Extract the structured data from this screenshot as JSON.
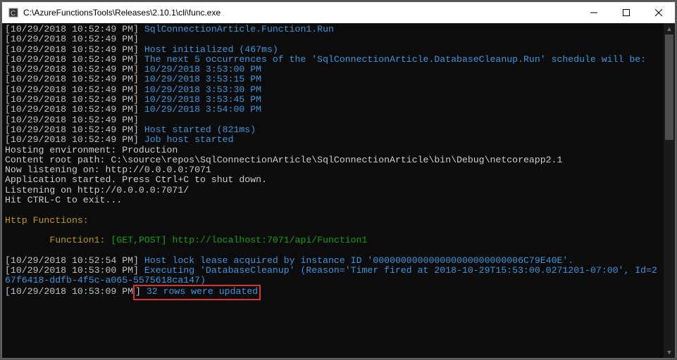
{
  "window": {
    "title": "C:\\AzureFunctionsTools\\Releases\\2.10.1\\cli\\func.exe"
  },
  "log": {
    "ts1": "[10/29/2018 10:52:49 PM]",
    "l1": "SqlConnectionArticle.Function1.Run",
    "l2": "Host initialized (467ms)",
    "l3": "The next 5 occurrences of the 'SqlConnectionArticle.DatabaseCleanup.Run' schedule will be:",
    "l4": "10/29/2018 3:53:00 PM",
    "l5": "10/29/2018 3:53:15 PM",
    "l6": "10/29/2018 3:53:30 PM",
    "l7": "10/29/2018 3:53:45 PM",
    "l8": "10/29/2018 3:54:00 PM",
    "l9": "Host started (821ms)",
    "l10": "Job host started",
    "env": "Hosting environment: Production",
    "root": "Content root path: C:\\source\\repos\\SqlConnectionArticle\\SqlConnectionArticle\\bin\\Debug\\netcoreapp2.1",
    "listen1": "Now listening on: http://0.0.0.0:7071",
    "appstart": "Application started. Press Ctrl+C to shut down.",
    "listen2": "Listening on http://0.0.0.0:7071/",
    "ctrlc": "Hit CTRL-C to exit...",
    "httpHeader": "Http Functions:",
    "fn1label": "Function1:",
    "fn1methods": "[GET,POST]",
    "fn1url": "http://localhost:7071/api/Function1",
    "ts2": "[10/29/2018 10:52:54 PM]",
    "lease": "Host lock lease acquired by instance ID '000000000000000000000000006C79E40E'.",
    "ts3": "[10/29/2018 10:53:00 PM]",
    "exec1": "Executing 'DatabaseCleanup' (Reason='Timer fired at 2018-10-29T15:53:00.0271201-07:00', Id=2",
    "exec2": "67f6418-ddfb-4f5c-a065-5575618ca147)",
    "ts4a": "[10/29/2018 10:53:09 PM",
    "ts4b": "]",
    "rows": " 32 rows were updated"
  }
}
